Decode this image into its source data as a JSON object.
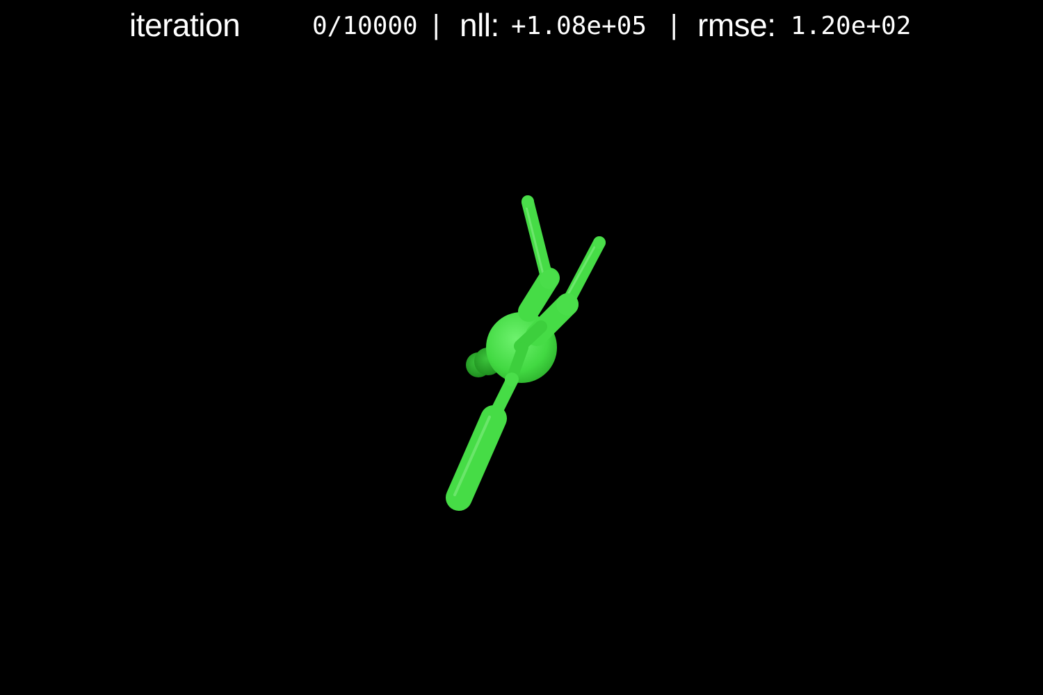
{
  "hud": {
    "iteration_label": "iteration",
    "iteration_value": "0/10000",
    "separator": "|",
    "nll_label": "nll:",
    "nll_value": "+1.08e+05",
    "rmse_label": "rmse:",
    "rmse_value": "1.20e+02"
  },
  "scene": {
    "background_color": "#000000",
    "model_color": "#44dd44",
    "model_highlight_color": "#8ef08e",
    "model_shadow_color": "#24a024"
  }
}
